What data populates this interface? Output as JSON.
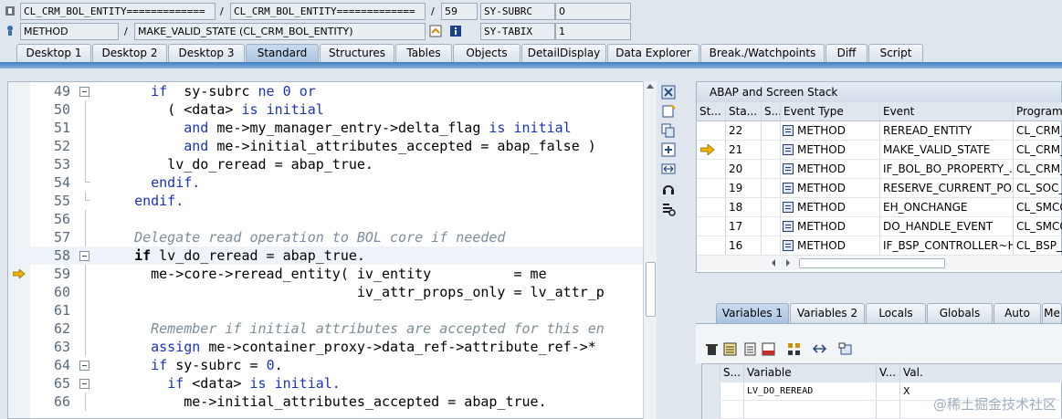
{
  "header": {
    "row1": {
      "field1": "CL_CRM_BOL_ENTITY=============",
      "field2": "CL_CRM_BOL_ENTITY=============",
      "line": "59",
      "sysvar": "SY-SUBRC",
      "sysval": "0"
    },
    "row2": {
      "kind": "METHOD",
      "name": "MAKE_VALID_STATE (CL_CRM_BOL_ENTITY)",
      "sysvar": "SY-TABIX",
      "sysval": "1"
    },
    "separator": "/"
  },
  "tabs": [
    {
      "label": "Desktop 1"
    },
    {
      "label": "Desktop 2"
    },
    {
      "label": "Desktop 3"
    },
    {
      "label": "Standard",
      "active": true
    },
    {
      "label": "Structures"
    },
    {
      "label": "Tables"
    },
    {
      "label": "Objects"
    },
    {
      "label": "DetailDisplay"
    },
    {
      "label": "Data Explorer"
    },
    {
      "label": "Break./Watchpoints"
    },
    {
      "label": "Diff"
    },
    {
      "label": "Script"
    }
  ],
  "code": {
    "lines": [
      {
        "num": "49",
        "indent": "    ",
        "parts": [
          [
            "kw",
            "if"
          ],
          [
            "",
            "  sy-subrc "
          ],
          [
            "kw",
            "ne"
          ],
          [
            "",
            " "
          ],
          [
            "num",
            "0"
          ],
          [
            "",
            " "
          ],
          [
            "kw",
            "or"
          ]
        ]
      },
      {
        "num": "50",
        "indent": "      ",
        "parts": [
          [
            "",
            "( <data> "
          ],
          [
            "kw",
            "is"
          ],
          [
            "",
            " "
          ],
          [
            "kw",
            "initial"
          ]
        ]
      },
      {
        "num": "51",
        "indent": "        ",
        "parts": [
          [
            "kw",
            "and"
          ],
          [
            "",
            " me->my_manager_entry->delta_flag "
          ],
          [
            "kw",
            "is"
          ],
          [
            "",
            " "
          ],
          [
            "kw",
            "initial"
          ]
        ]
      },
      {
        "num": "52",
        "indent": "        ",
        "parts": [
          [
            "kw",
            "and"
          ],
          [
            "",
            " me->initial_attributes_accepted = abap_false )"
          ]
        ]
      },
      {
        "num": "53",
        "indent": "      ",
        "parts": [
          [
            "",
            "lv_do_reread = abap_true."
          ]
        ]
      },
      {
        "num": "54",
        "indent": "    ",
        "parts": [
          [
            "kw",
            "endif."
          ]
        ]
      },
      {
        "num": "55",
        "indent": "  ",
        "parts": [
          [
            "kw",
            "endif."
          ]
        ]
      },
      {
        "num": "56",
        "indent": "",
        "parts": [
          [
            "",
            ""
          ]
        ]
      },
      {
        "num": "57",
        "indent": "  ",
        "parts": [
          [
            "cmt",
            "Delegate read operation to BOL core if needed"
          ]
        ]
      },
      {
        "num": "58",
        "indent": "  ",
        "parts": [
          [
            "bold",
            "if"
          ],
          [
            "",
            " lv_do_reread = abap_true."
          ]
        ]
      },
      {
        "num": "59",
        "indent": "    ",
        "parts": [
          [
            "",
            "me->core->reread_entity( iv_entity          = me"
          ]
        ]
      },
      {
        "num": "60",
        "indent": "                             ",
        "parts": [
          [
            "",
            "iv_attr_props_only = lv_attr_p"
          ]
        ]
      },
      {
        "num": "61",
        "indent": "",
        "parts": [
          [
            "",
            ""
          ]
        ]
      },
      {
        "num": "62",
        "indent": "    ",
        "parts": [
          [
            "cmt",
            "Remember if initial attributes are accepted for this en"
          ]
        ]
      },
      {
        "num": "63",
        "indent": "    ",
        "parts": [
          [
            "kw",
            "assign"
          ],
          [
            "",
            " me->container_proxy->data_ref->attribute_ref->*"
          ]
        ]
      },
      {
        "num": "64",
        "indent": "    ",
        "parts": [
          [
            "kw",
            "if"
          ],
          [
            "",
            " sy-subrc = "
          ],
          [
            "num",
            "0"
          ],
          [
            "",
            "."
          ]
        ]
      },
      {
        "num": "65",
        "indent": "      ",
        "parts": [
          [
            "kw",
            "if"
          ],
          [
            "",
            " <data> "
          ],
          [
            "kw",
            "is"
          ],
          [
            "",
            " "
          ],
          [
            "kw",
            "initial."
          ]
        ]
      },
      {
        "num": "66",
        "indent": "        ",
        "parts": [
          [
            "",
            "me->initial_attributes_accepted = abap_true."
          ]
        ]
      }
    ]
  },
  "stack": {
    "title": "ABAP and Screen Stack",
    "columns": [
      "St...",
      "Sta...",
      "S...",
      "Event Type",
      "Event",
      "Program"
    ],
    "rows": [
      {
        "level": "22",
        "type": "METHOD",
        "event": "REREAD_ENTITY",
        "program": "CL_CRM_B",
        "current": false
      },
      {
        "level": "21",
        "type": "METHOD",
        "event": "MAKE_VALID_STATE",
        "program": "CL_CRM_B",
        "current": true
      },
      {
        "level": "20",
        "type": "METHOD",
        "event": "IF_BOL_BO_PROPERTY_...",
        "program": "CL_CRM_B",
        "current": false
      },
      {
        "level": "19",
        "type": "METHOD",
        "event": "RESERVE_CURRENT_PO...",
        "program": "CL_SOC_U",
        "current": false
      },
      {
        "level": "18",
        "type": "METHOD",
        "event": "EH_ONCHANGE",
        "program": "CL_SMCOV",
        "current": false
      },
      {
        "level": "17",
        "type": "METHOD",
        "event": "DO_HANDLE_EVENT",
        "program": "CL_SMCOV",
        "current": false
      },
      {
        "level": "16",
        "type": "METHOD",
        "event": "IF_BSP_CONTROLLER~H...",
        "program": "CL_BSP_C",
        "current": false
      }
    ]
  },
  "variables": {
    "tabs": [
      {
        "label": "Variables 1",
        "active": true
      },
      {
        "label": "Variables 2"
      },
      {
        "label": "Locals"
      },
      {
        "label": "Globals"
      },
      {
        "label": "Auto"
      },
      {
        "label": "Me"
      }
    ],
    "columns": [
      "S...",
      "Variable",
      "V...",
      "Val."
    ],
    "rows": [
      {
        "variable": "LV_DO_REREAD",
        "value": "X"
      }
    ]
  },
  "watermark": "@稀土掘金技术社区",
  "colors": {
    "keyword": "#1b32bd",
    "comment": "#7c8c98",
    "accent_band": "#3f7fc4",
    "exec_arrow": "#f0b400"
  }
}
